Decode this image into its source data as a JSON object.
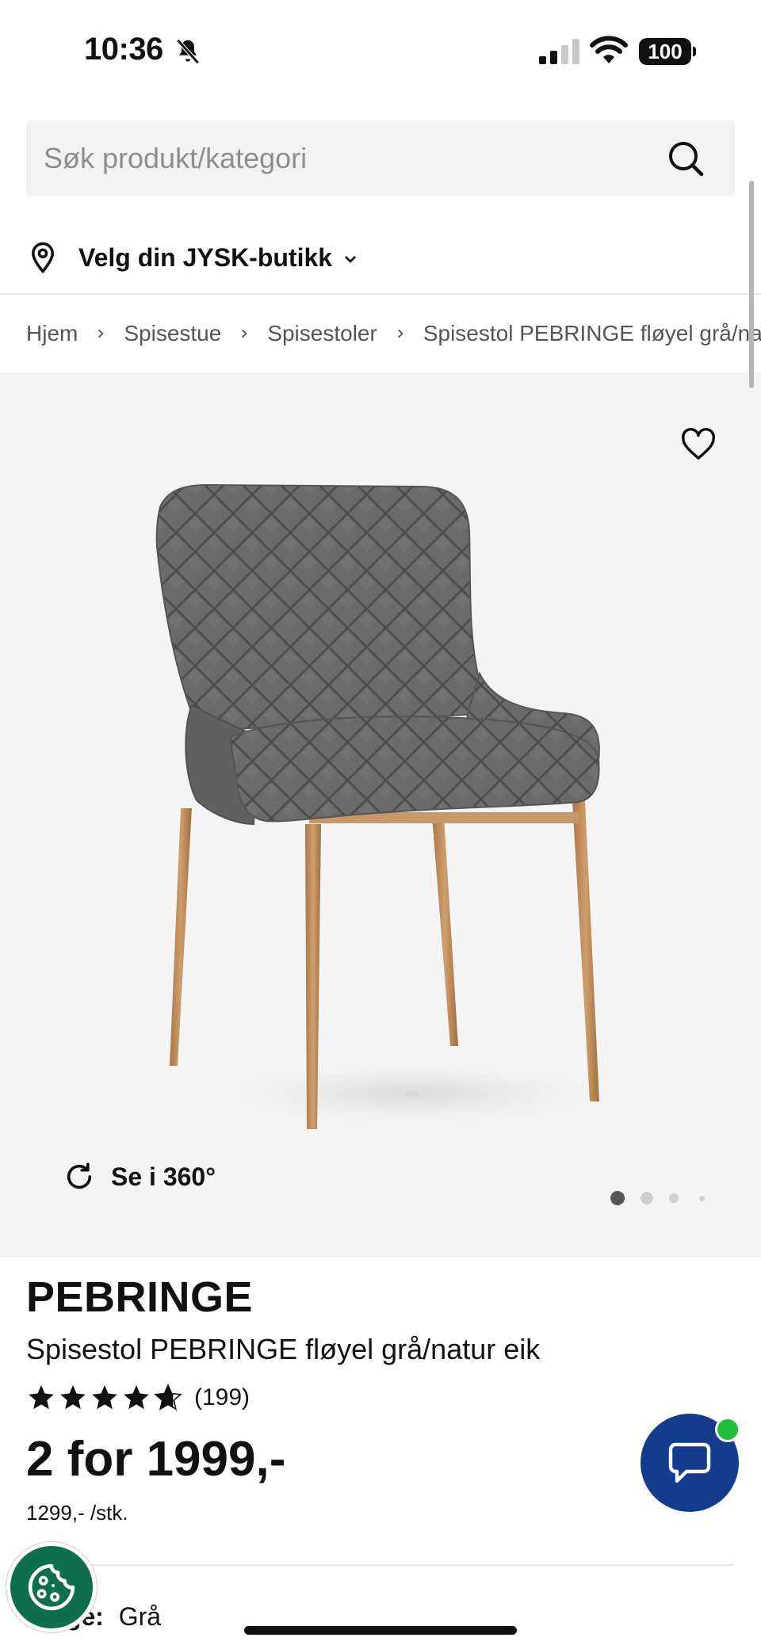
{
  "status_bar": {
    "time": "10:36",
    "battery": "100"
  },
  "search": {
    "placeholder": "Søk produkt/kategori"
  },
  "store": {
    "label": "Velg din JYSK-butikk"
  },
  "breadcrumb": {
    "items": [
      "Hjem",
      "Spisestue",
      "Spisestoler",
      "Spisestol PEBRINGE fløyel grå/natur eik"
    ]
  },
  "gallery": {
    "rotate_label": "Se i 360°",
    "current_image": 1,
    "image_count": 4
  },
  "product": {
    "brand": "PEBRINGE",
    "name": "Spisestol PEBRINGE fløyel grå/natur eik",
    "rating": 4.6,
    "rating_max": 5,
    "review_count": "(199)",
    "price": "2 for 1999,-",
    "unit_price": "1299,- /stk.",
    "color_key": "Farge:",
    "color_value": "Grå"
  },
  "colors": {
    "chat_button": "#143c8c",
    "chat_online": "#1fbf3a",
    "cookie_button": "#0f6e4c",
    "image_background": "#f4f4f4"
  },
  "icons": {
    "search": "search-icon",
    "store": "location-pin-icon",
    "favorite": "heart-icon",
    "rotate": "rotate-360-icon",
    "chat": "chat-bubble-icon",
    "cookie": "cookie-icon"
  }
}
